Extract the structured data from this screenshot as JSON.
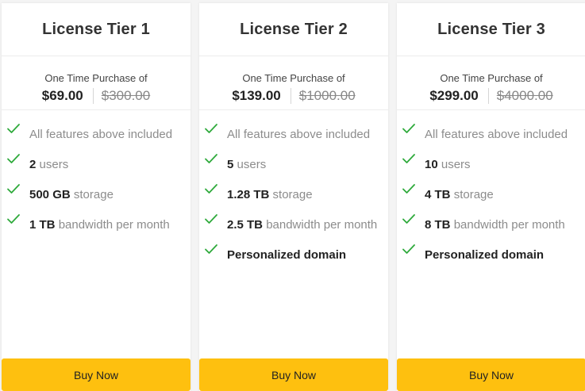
{
  "tiers": [
    {
      "title": "License Tier 1",
      "price_caption": "One Time Purchase of",
      "price": "$69.00",
      "original_price": "$300.00",
      "features": [
        {
          "strong": "",
          "text": "All features above included"
        },
        {
          "strong": "2",
          "text": "users"
        },
        {
          "strong": "500 GB",
          "text": "storage"
        },
        {
          "strong": "1 TB",
          "text": "bandwidth per month"
        }
      ],
      "button_label": "Buy Now"
    },
    {
      "title": "License Tier 2",
      "price_caption": "One Time Purchase of",
      "price": "$139.00",
      "original_price": "$1000.00",
      "features": [
        {
          "strong": "",
          "text": "All features above included"
        },
        {
          "strong": "5",
          "text": "users"
        },
        {
          "strong": "1.28 TB",
          "text": "storage"
        },
        {
          "strong": "2.5 TB",
          "text": "bandwidth per month"
        },
        {
          "strong": "Personalized domain",
          "text": ""
        }
      ],
      "button_label": "Buy Now"
    },
    {
      "title": "License Tier 3",
      "price_caption": "One Time Purchase of",
      "price": "$299.00",
      "original_price": "$4000.00",
      "features": [
        {
          "strong": "",
          "text": "All features above included"
        },
        {
          "strong": "10",
          "text": "users"
        },
        {
          "strong": "4 TB",
          "text": "storage"
        },
        {
          "strong": "8 TB",
          "text": "bandwidth per month"
        },
        {
          "strong": "Personalized domain",
          "text": ""
        }
      ],
      "button_label": "Buy Now"
    }
  ],
  "colors": {
    "accent_button": "#fec00f",
    "check": "#2faa3c",
    "muted_text": "#8c8c8c"
  },
  "icons": {
    "feature_bullet": "check-icon"
  }
}
